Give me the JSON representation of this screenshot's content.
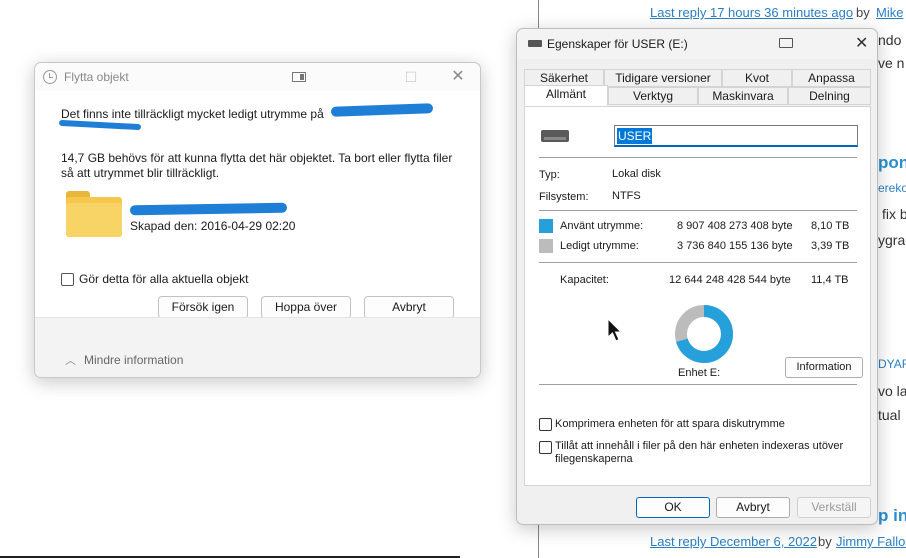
{
  "background": {
    "top_link": "Last reply 17 hours 36 minutes ago",
    "top_by": "by",
    "top_author": "Mike",
    "bottom_link": "Last reply December 6, 2022",
    "bottom_by": "by",
    "bottom_author": "Jimmy Fallon",
    "side_fragments": [
      "ndo",
      "ve n",
      "pon",
      "ereko",
      "fix b",
      "ygra",
      "DYAR",
      "vo la",
      "tual",
      "p in"
    ]
  },
  "move_dialog": {
    "title": "Flytta objekt",
    "message_line1": "Det finns inte tillräckligt mycket ledigt utrymme på",
    "message_line2": "14,7 GB behövs för att kunna flytta det här objektet. Ta bort eller flytta filer så att utrymmet blir tillräckligt.",
    "created": "Skapad den: 2016-04-29 02:20",
    "checkbox_label": "Gör detta för alla aktuella objekt",
    "retry": "Försök igen",
    "skip": "Hoppa över",
    "cancel": "Avbryt",
    "less_info": "Mindre information"
  },
  "properties_dialog": {
    "title": "Egenskaper för USER (E:)",
    "tabs_row1": [
      "Säkerhet",
      "Tidigare versioner",
      "Kvot",
      "Anpassa"
    ],
    "tabs_row2": [
      "Allmänt",
      "Verktyg",
      "Maskinvara",
      "Delning"
    ],
    "active_tab": "Allmänt",
    "volume_name": "USER",
    "type_label": "Typ:",
    "type_value": "Lokal disk",
    "fs_label": "Filsystem:",
    "fs_value": "NTFS",
    "used_label": "Använt utrymme:",
    "used_bytes": "8 907 408 273 408 byte",
    "used_size": "8,10 TB",
    "free_label": "Ledigt utrymme:",
    "free_bytes": "3 736 840 155 136 byte",
    "free_size": "3,39 TB",
    "capacity_label": "Kapacitet:",
    "capacity_bytes": "12 644 248 428 544 byte",
    "capacity_size": "11,4 TB",
    "used_fraction": 0.7045,
    "used_color": "#26a0da",
    "free_color": "#bcbcbc",
    "drive_label": "Enhet E:",
    "info_button": "Information",
    "compress_label": "Komprimera enheten för att spara diskutrymme",
    "index_label": "Tillåt att innehåll i filer på den här enheten indexeras utöver filegenskaperna",
    "ok": "OK",
    "cancel": "Avbryt",
    "apply": "Verkställ"
  }
}
